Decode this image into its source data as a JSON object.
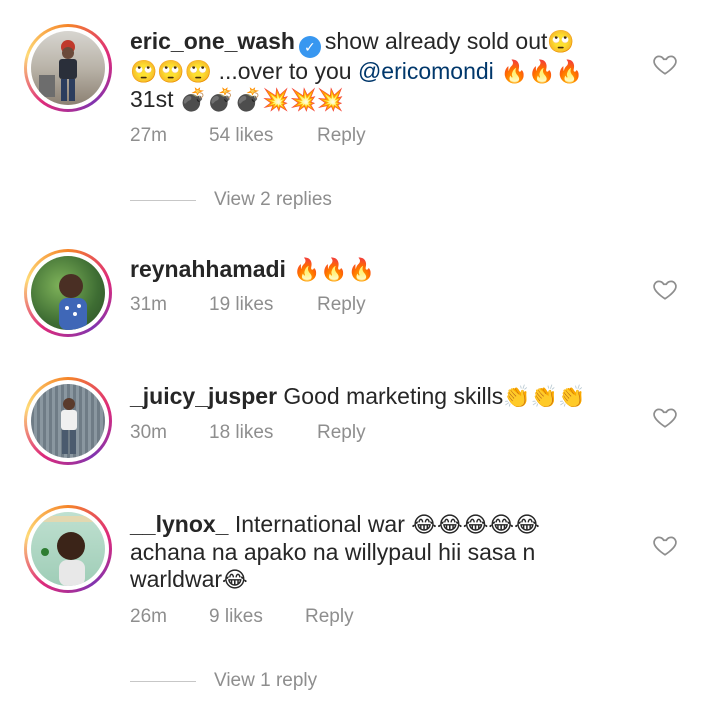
{
  "comments": [
    {
      "username": "eric_one_wash",
      "verified": true,
      "text_before": "show already sold out",
      "emoji1": "🙄",
      "emoji2": "🙄🙄🙄",
      "text_mid": " ...over to you ",
      "mention": "@ericomondi",
      "emoji3": " 🔥🔥🔥",
      "text_end": "31st ",
      "emoji4": "💣💣💣💥💥💥",
      "time": "27m",
      "likes": "54 likes",
      "reply": "Reply",
      "view_replies": "View 2 replies"
    },
    {
      "username": "reynahhamadi",
      "text": " 🔥🔥🔥",
      "time": "31m",
      "likes": "19 likes",
      "reply": "Reply"
    },
    {
      "username": "_juicy_jusper",
      "text": " Good marketing skills",
      "emoji": "👏👏👏",
      "time": "30m",
      "likes": "18 likes",
      "reply": "Reply"
    },
    {
      "username": "__lynox_",
      "text1": " International  war ",
      "emoji1": "😂😂😂😂😂",
      "text2": "achana na apako na willypaul  hii sasa n warldwar",
      "emoji2": "😂",
      "time": "26m",
      "likes": "9 likes",
      "reply": "Reply",
      "view_replies": "View 1 reply"
    }
  ],
  "colors": {
    "accent": "#3897f0",
    "muted": "#8e8e8e",
    "mention": "#00376b"
  },
  "icons": {
    "like": "heart-outline-icon",
    "verified": "verified-badge-icon"
  }
}
